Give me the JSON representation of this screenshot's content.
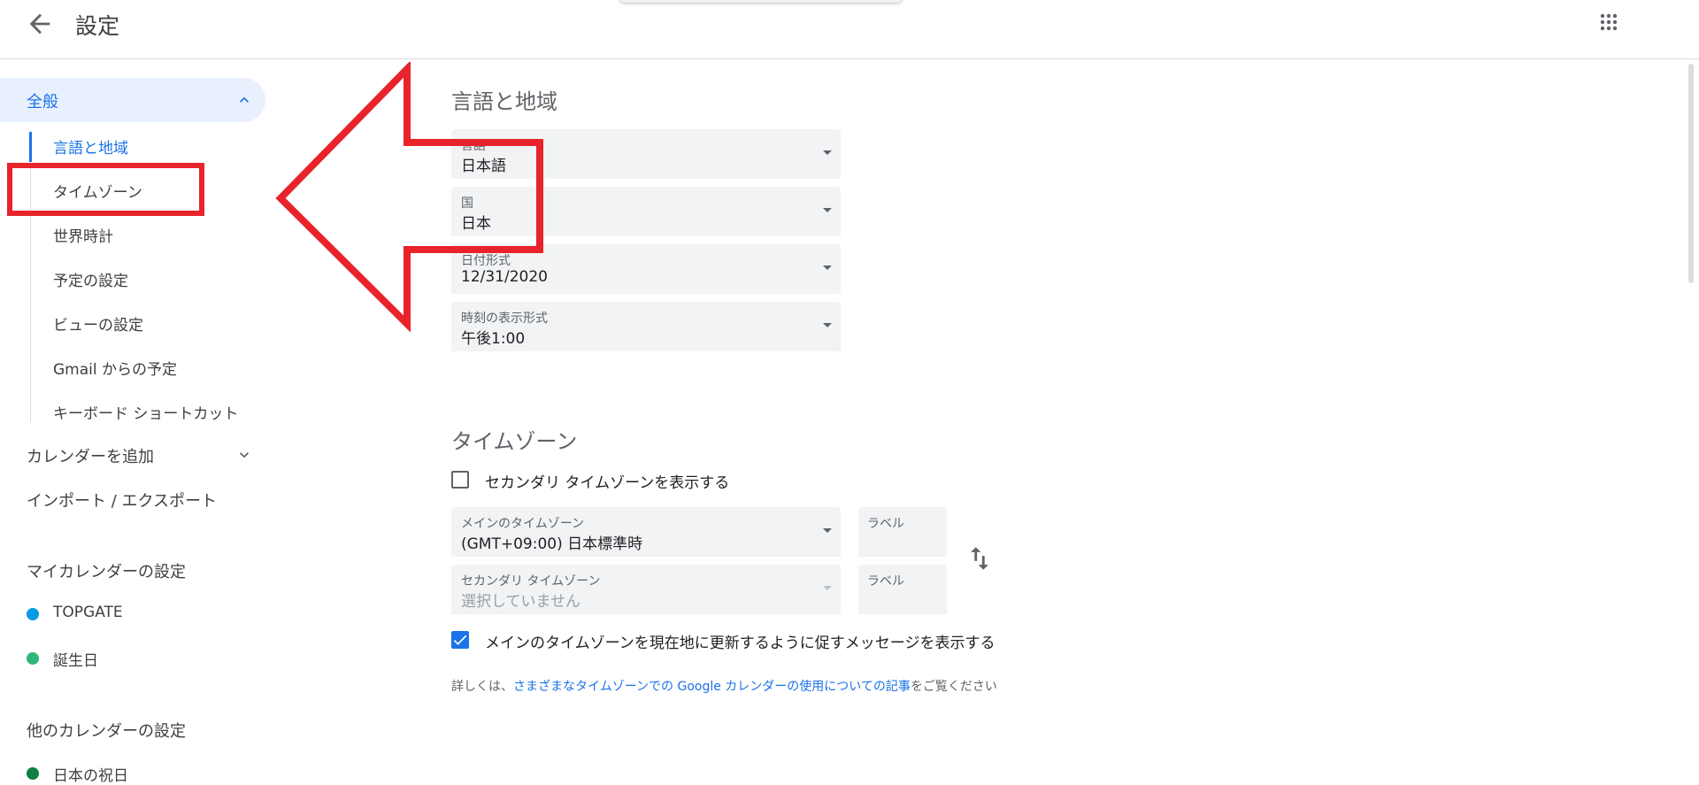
{
  "header": {
    "title": "設定",
    "back_icon": "arrow-back-icon",
    "apps_icon": "apps-grid-icon"
  },
  "sidebar": {
    "general": {
      "label": "全般",
      "expanded": true
    },
    "sub_items": [
      {
        "label": "言語と地域",
        "active": true
      },
      {
        "label": "タイムゾーン",
        "active": false
      },
      {
        "label": "世界時計",
        "active": false
      },
      {
        "label": "予定の設定",
        "active": false
      },
      {
        "label": "ビューの設定",
        "active": false
      },
      {
        "label": "Gmail からの予定",
        "active": false
      },
      {
        "label": "キーボード ショートカット",
        "active": false
      }
    ],
    "add_calendar": "カレンダーを追加",
    "import_export": "インポート / エクスポート",
    "my_calendars_header": "マイカレンダーの設定",
    "my_calendars": [
      {
        "label": "TOPGATE",
        "color": "#039be5"
      },
      {
        "label": "誕生日",
        "color": "#33b679"
      }
    ],
    "other_calendars_header": "他のカレンダーの設定",
    "other_calendars": [
      {
        "label": "日本の祝日",
        "color": "#0b8043"
      }
    ]
  },
  "language_region": {
    "title": "言語と地域",
    "language": {
      "label": "言語",
      "value": "日本語"
    },
    "country": {
      "label": "国",
      "value": "日本"
    },
    "date_format": {
      "label": "日付形式",
      "value": "12/31/2020"
    },
    "time_format": {
      "label": "時刻の表示形式",
      "value": "午後1:00"
    }
  },
  "timezone": {
    "title": "タイムゾーン",
    "show_secondary": {
      "label": "セカンダリ タイムゾーンを表示する",
      "checked": false
    },
    "primary": {
      "label": "メインのタイムゾーン",
      "value": "(GMT+09:00) 日本標準時"
    },
    "primary_label": {
      "label": "ラベル"
    },
    "secondary": {
      "label": "セカンダリ タイムゾーン",
      "value": "選択していません"
    },
    "secondary_label": {
      "label": "ラベル"
    },
    "swap_icon": "swap-vert-icon",
    "ask_update": {
      "label": "メインのタイムゾーンを現在地に更新するように促すメッセージを表示する",
      "checked": true
    },
    "info_prefix": "詳しくは、",
    "info_link": "さまざまなタイムゾーンでの Google カレンダーの使用についての記事",
    "info_suffix": "をご覧ください"
  },
  "colors": {
    "accent": "#1a73e8",
    "annotation_red": "#e8232b"
  }
}
